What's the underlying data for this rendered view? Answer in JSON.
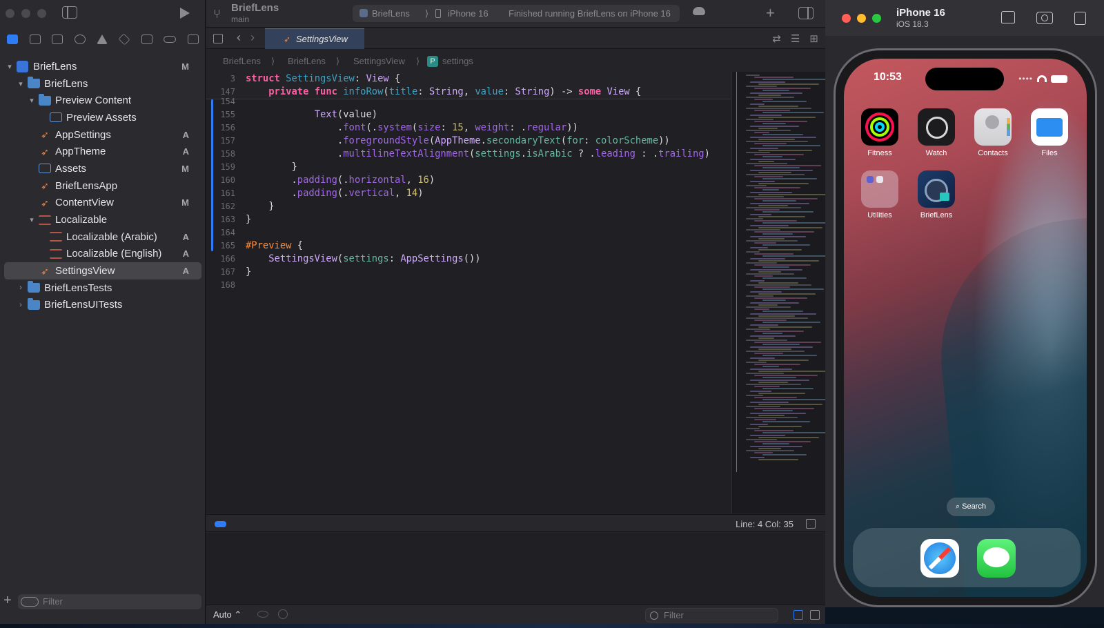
{
  "window": {
    "project_name": "BriefLens",
    "branch": "main"
  },
  "toolbar": {
    "scheme_app": "BriefLens",
    "scheme_separator": "⟩",
    "scheme_device": "iPhone 16",
    "status": "Finished running BriefLens on iPhone 16"
  },
  "navigator": {
    "items": [
      {
        "label": "BriefLens",
        "badge": "M",
        "depth": 0,
        "kind": "proj",
        "chev": "▾"
      },
      {
        "label": "BriefLens",
        "badge": "",
        "depth": 1,
        "kind": "folder",
        "chev": "▾"
      },
      {
        "label": "Preview Content",
        "badge": "",
        "depth": 2,
        "kind": "folder",
        "chev": "▾"
      },
      {
        "label": "Preview Assets",
        "badge": "",
        "depth": 3,
        "kind": "assets",
        "chev": ""
      },
      {
        "label": "AppSettings",
        "badge": "A",
        "depth": 2,
        "kind": "swift",
        "chev": ""
      },
      {
        "label": "AppTheme",
        "badge": "A",
        "depth": 2,
        "kind": "swift",
        "chev": ""
      },
      {
        "label": "Assets",
        "badge": "M",
        "depth": 2,
        "kind": "assets",
        "chev": ""
      },
      {
        "label": "BriefLensApp",
        "badge": "",
        "depth": 2,
        "kind": "swift",
        "chev": ""
      },
      {
        "label": "ContentView",
        "badge": "M",
        "depth": 2,
        "kind": "swift",
        "chev": ""
      },
      {
        "label": "Localizable",
        "badge": "",
        "depth": 2,
        "kind": "strings",
        "chev": "▾"
      },
      {
        "label": "Localizable (Arabic)",
        "badge": "A",
        "depth": 3,
        "kind": "strings",
        "chev": ""
      },
      {
        "label": "Localizable (English)",
        "badge": "A",
        "depth": 3,
        "kind": "strings",
        "chev": ""
      },
      {
        "label": "SettingsView",
        "badge": "A",
        "depth": 2,
        "kind": "swift",
        "chev": "",
        "selected": true
      },
      {
        "label": "BriefLensTests",
        "badge": "",
        "depth": 1,
        "kind": "folder",
        "chev": "›"
      },
      {
        "label": "BriefLensUITests",
        "badge": "",
        "depth": 1,
        "kind": "folder",
        "chev": "›"
      }
    ],
    "filter_placeholder": "Filter"
  },
  "editor": {
    "active_tab": "SettingsView",
    "breadcrumb": [
      "BriefLens",
      "BriefLens",
      "SettingsView",
      "settings"
    ],
    "sticky": [
      {
        "n": "3",
        "code": "<span class=\"kw\">struct</span> <span class=\"ms\">SettingsView</span>: <span class=\"ty\">View</span> {"
      },
      {
        "n": "147",
        "code": "    <span class=\"kw\">private</span> <span class=\"kw\">func</span> <span class=\"ms\">infoRow</span>(<span class=\"ms\">title</span>: <span class=\"ty\">String</span>, <span class=\"ms\">value</span>: <span class=\"ty\">String</span>) -&gt; <span class=\"kw\">some</span> <span class=\"ty\">View</span> {"
      }
    ],
    "lines": [
      {
        "n": "154",
        "code": ""
      },
      {
        "n": "155",
        "code": "            <span class=\"ty\">Text</span>(value)"
      },
      {
        "n": "156",
        "code": "                .<span class=\"pr\">font</span>(.<span class=\"pr\">system</span>(<span class=\"pr\">size</span>: <span class=\"nm\">15</span>, <span class=\"pr\">weight</span>: .<span class=\"pr\">regular</span>))"
      },
      {
        "n": "157",
        "code": "                .<span class=\"pr\">foregroundStyle</span>(<span class=\"ty\">AppTheme</span>.<span class=\"fn\">secondaryText</span>(<span class=\"fn\">for</span>: <span class=\"fn\">colorScheme</span>))"
      },
      {
        "n": "158",
        "code": "                .<span class=\"pr\">multilineTextAlignment</span>(<span class=\"fn\">settings</span>.<span class=\"fn\">isArabic</span> ? .<span class=\"pr\">leading</span> : .<span class=\"pr\">trailing</span>)"
      },
      {
        "n": "159",
        "code": "        }"
      },
      {
        "n": "160",
        "code": "        .<span class=\"pr\">padding</span>(.<span class=\"pr\">horizontal</span>, <span class=\"nm\">16</span>)"
      },
      {
        "n": "161",
        "code": "        .<span class=\"pr\">padding</span>(.<span class=\"pr\">vertical</span>, <span class=\"nm\">14</span>)"
      },
      {
        "n": "162",
        "code": "    }"
      },
      {
        "n": "163",
        "code": "}"
      },
      {
        "n": "164",
        "code": ""
      },
      {
        "n": "165",
        "code": "<span class=\"mc\">#Preview</span> {"
      },
      {
        "n": "166",
        "code": "    <span class=\"ty\">SettingsView</span>(<span class=\"fn\">settings</span>: <span class=\"ty\">AppSettings</span>())"
      },
      {
        "n": "167",
        "code": "}"
      },
      {
        "n": "168",
        "code": ""
      }
    ],
    "cursor": "Line: 4  Col: 35"
  },
  "debug": {
    "auto_label": "Auto ⌃",
    "filter_placeholder": "Filter"
  },
  "simulator": {
    "device": "iPhone 16",
    "os": "iOS 18.3",
    "time": "10:53",
    "apps": [
      {
        "name": "Fitness",
        "icon": "fitness"
      },
      {
        "name": "Watch",
        "icon": "watch"
      },
      {
        "name": "Contacts",
        "icon": "contacts"
      },
      {
        "name": "Files",
        "icon": "files"
      },
      {
        "name": "Utilities",
        "icon": "utilities"
      },
      {
        "name": "BriefLens",
        "icon": "brieflens"
      }
    ],
    "search_label": "Search",
    "dock": [
      "safari",
      "messages"
    ]
  },
  "colors": {
    "accent": "#2f7df6",
    "keyword": "#fc5fa3",
    "type": "#d0a8ff",
    "number": "#d0bf69",
    "macro": "#fd8f3f",
    "traffic_red": "#ff5f57",
    "traffic_yellow": "#febc2e",
    "traffic_green": "#28c840"
  }
}
